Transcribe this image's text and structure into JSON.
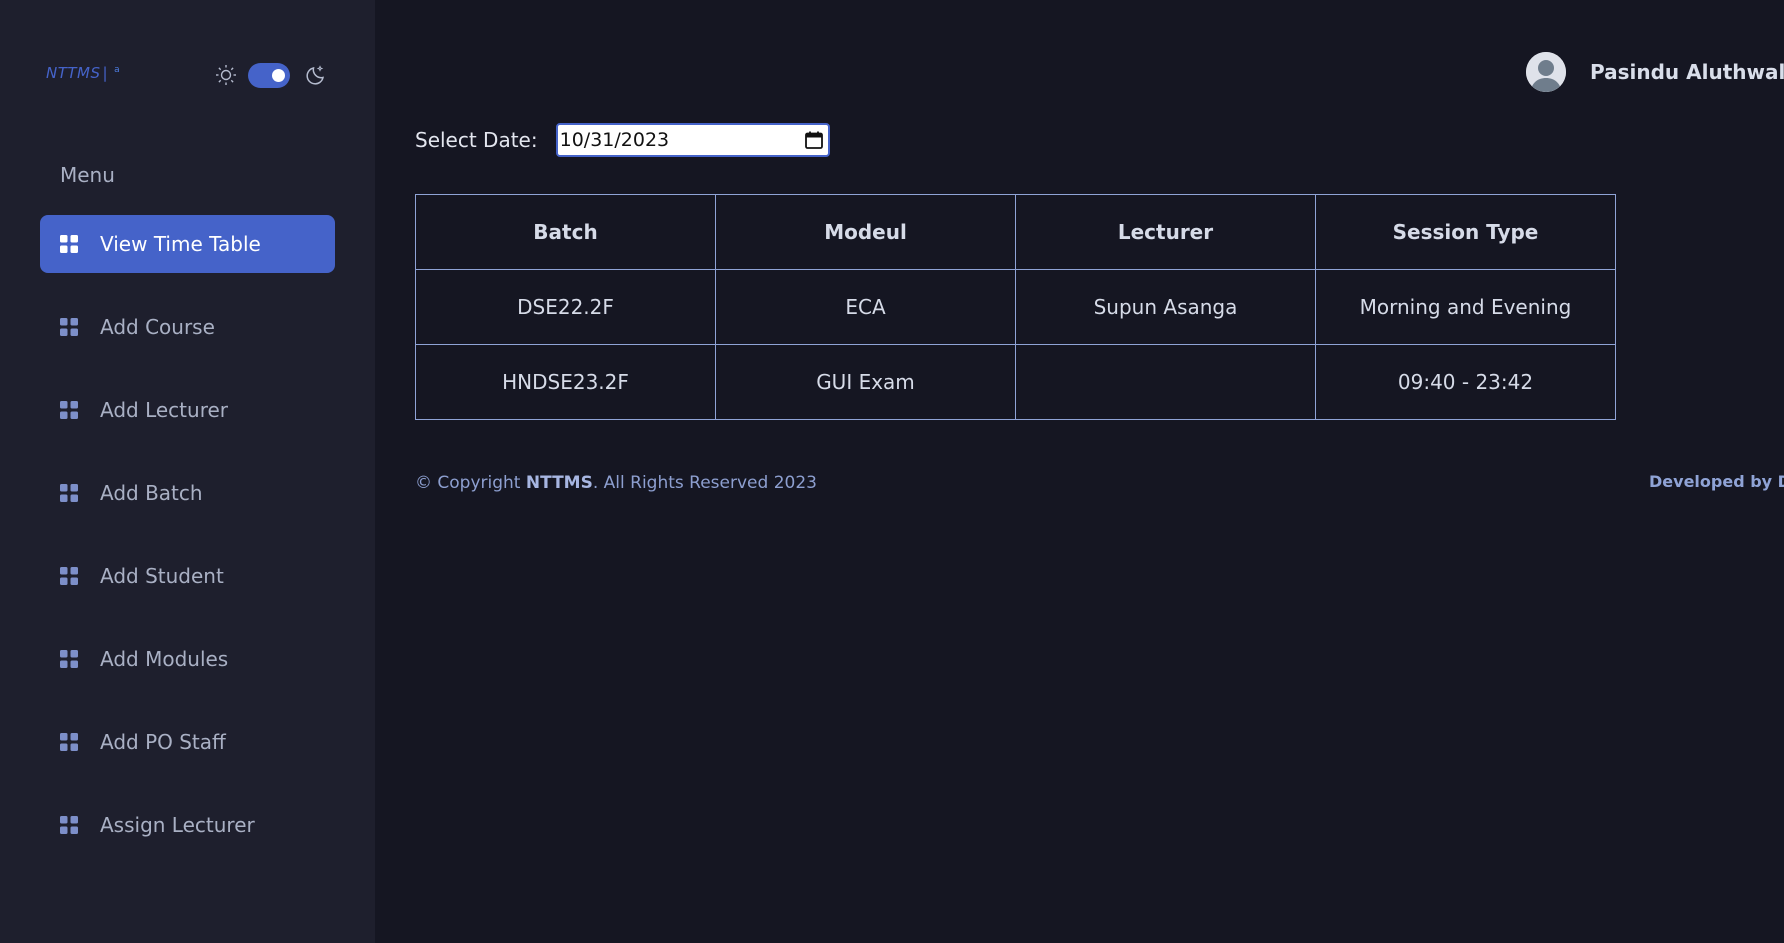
{
  "sidebar": {
    "logo": "NTTMS",
    "logo_sep": "|",
    "logo_sup": "a",
    "menu_heading": "Menu",
    "items": [
      {
        "label": "View Time Table",
        "active": true
      },
      {
        "label": "Add Course"
      },
      {
        "label": "Add Lecturer"
      },
      {
        "label": "Add Batch"
      },
      {
        "label": "Add Student"
      },
      {
        "label": "Add Modules"
      },
      {
        "label": "Add PO Staff"
      },
      {
        "label": "Assign Lecturer"
      }
    ]
  },
  "header": {
    "user_name": "Pasindu Aluthwalahe"
  },
  "date_picker": {
    "label": "Select Date:",
    "value": "10/31/2023"
  },
  "table": {
    "headers": [
      "Batch",
      "Modeul",
      "Lecturer",
      "Session Type"
    ],
    "rows": [
      [
        "DSE22.2F",
        "ECA",
        "Supun Asanga",
        "Morning and Evening"
      ],
      [
        "HNDSE23.2F",
        "GUI Exam",
        "",
        "09:40 - 23:42"
      ]
    ]
  },
  "footer": {
    "copyright_prefix": "© Copyright ",
    "brand": "NTTMS",
    "copyright_suffix": ". All Rights Reserved 2023",
    "developed_by": "Developed by DSE"
  },
  "colors": {
    "accent": "#4563c9",
    "background": "#151622",
    "sidebar": "#1e1f2d"
  }
}
